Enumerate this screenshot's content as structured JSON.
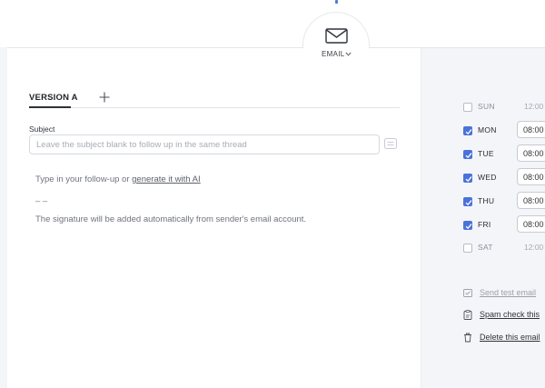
{
  "channel": {
    "label": "EMAIL",
    "icon": "mail-icon"
  },
  "editor": {
    "tab_label": "VERSION A",
    "subject_label": "Subject",
    "subject_value": "",
    "subject_placeholder": "Leave the subject blank to follow up in the same thread",
    "body_prefix": "Type in your follow-up or ",
    "body_ai_link": "generate it with AI",
    "signature_sep": "– –",
    "signature_note": "The signature will be added automatically from sender's email account."
  },
  "schedule": {
    "days": [
      {
        "label": "SUN",
        "checked": false,
        "time": "12:00"
      },
      {
        "label": "MON",
        "checked": true,
        "time": "08:00"
      },
      {
        "label": "TUE",
        "checked": true,
        "time": "08:00"
      },
      {
        "label": "WED",
        "checked": true,
        "time": "08:00"
      },
      {
        "label": "THU",
        "checked": true,
        "time": "08:00"
      },
      {
        "label": "FRI",
        "checked": true,
        "time": "08:00"
      },
      {
        "label": "SAT",
        "checked": false,
        "time": "12:00"
      }
    ]
  },
  "actions": {
    "send_test": "Send test email",
    "spam_check": "Spam check this",
    "delete": "Delete this email"
  },
  "colors": {
    "accent": "#4a73d9",
    "panel_bg": "#f4f5f8",
    "editor_bg": "#ffffff"
  }
}
